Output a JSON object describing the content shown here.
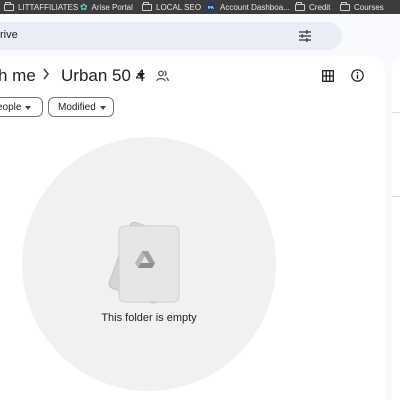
{
  "bookmarks": [
    {
      "label": "LITTAFFILIATES",
      "icon": "folder-icon"
    },
    {
      "label": "Arise Portal",
      "icon": "star-icon"
    },
    {
      "label": "LOCAL SEO",
      "icon": "folder-icon"
    },
    {
      "label": "Account Dashboa...",
      "icon": "fa-favicon",
      "icon_text": "FA"
    },
    {
      "label": "Credit",
      "icon": "folder-icon"
    },
    {
      "label": "Courses",
      "icon": "folder-icon"
    }
  ],
  "search": {
    "text": "rive"
  },
  "breadcrumb": {
    "previous": "h me",
    "current": "Urban 50 4"
  },
  "filters": {
    "people_label": "eople",
    "modified_label": "Modified"
  },
  "empty_state": {
    "message": "This folder is empty"
  },
  "colors": {
    "background": "#f8fafd",
    "search_bg": "#e9eef6",
    "bookmarks_bg": "#3c3c3c",
    "empty_circle": "#f1f1f1"
  }
}
